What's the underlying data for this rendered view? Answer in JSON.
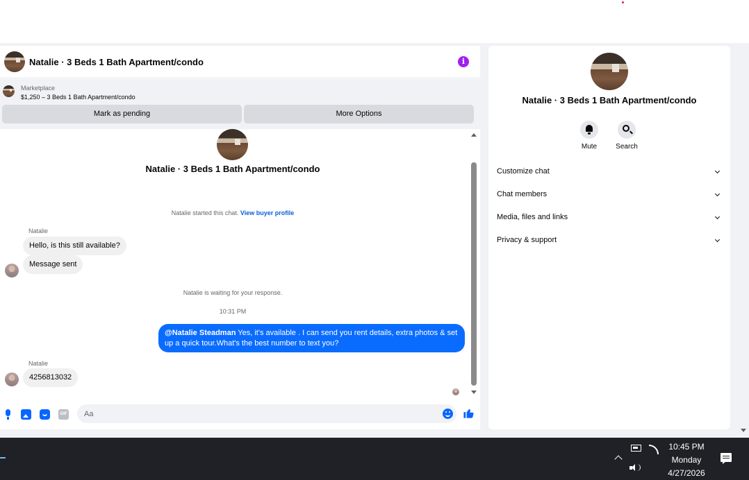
{
  "chat": {
    "title": "Natalie · 3 Beds 1 Bath Apartment/condo",
    "marketplace": {
      "label": "Marketplace",
      "listing": "$1,250 – 3 Beds 1 Bath Apartment/condo",
      "pending_button": "Mark as pending",
      "options_button": "More Options"
    },
    "conversation_title": "Natalie · 3 Beds 1 Bath Apartment/condo",
    "started_text": "Natalie started this chat.",
    "buyer_profile_link": "View buyer profile",
    "sender_name": "Natalie",
    "message_1": "Hello, is this still available?",
    "message_2": "Message sent",
    "waiting_text": "Natalie is waiting for your response.",
    "timestamp": "10:31 PM",
    "outgoing_mention": "@Natalie Steadman",
    "outgoing_text": " Yes, it's available .  I can send you rent details, extra photos & set up a quick tour.What's the best number to text you?",
    "sender_name_2": "Natalie",
    "message_3": "4256813032",
    "composer_placeholder": "Aa",
    "gif_label": "GIF"
  },
  "info_panel": {
    "title": "Natalie · 3 Beds 1 Bath Apartment/condo",
    "mute_label": "Mute",
    "search_label": "Search",
    "menu": [
      {
        "label": "Customize chat"
      },
      {
        "label": "Chat members"
      },
      {
        "label": "Media, files and links"
      },
      {
        "label": "Privacy & support"
      }
    ]
  },
  "taskbar": {
    "time": "10:45 PM",
    "day": "Monday",
    "date": "4/27/2026"
  },
  "colors": {
    "accent": "#0866ff",
    "outgoing_bubble": "#0a6cff",
    "info_icon": "#a020f0"
  }
}
